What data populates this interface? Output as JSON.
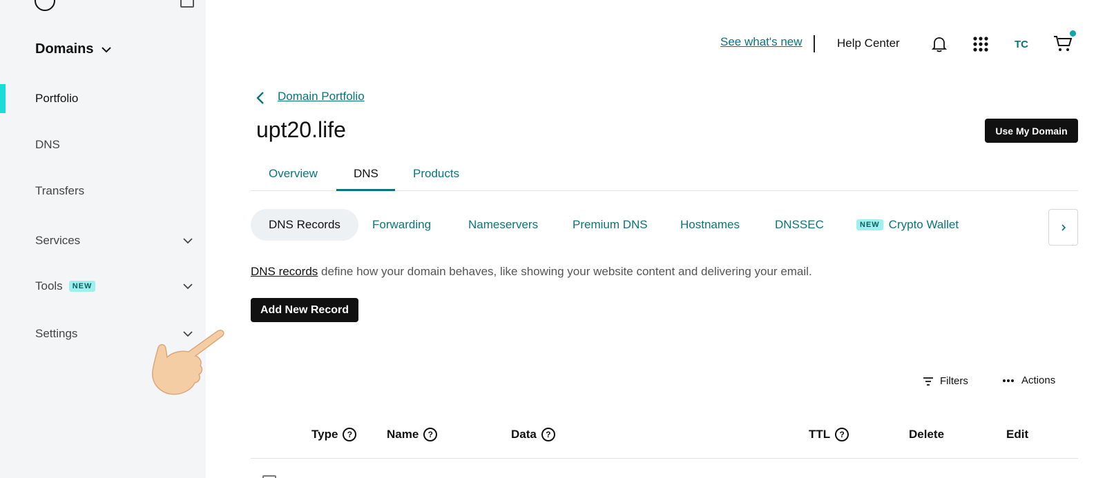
{
  "sidebar": {
    "title": "Domains",
    "items": [
      {
        "label": "Portfolio"
      },
      {
        "label": "DNS"
      },
      {
        "label": "Transfers"
      },
      {
        "label": "Services"
      },
      {
        "label": "Tools",
        "badge": "NEW"
      },
      {
        "label": "Settings"
      }
    ]
  },
  "topbar": {
    "whats_new": "See what's new",
    "help_center": "Help Center",
    "initials": "TC"
  },
  "breadcrumb": "Domain Portfolio",
  "page_title": "upt20.life",
  "use_domain_button": "Use My Domain",
  "tabs": [
    "Overview",
    "DNS",
    "Products"
  ],
  "subtabs": {
    "items": [
      "DNS Records",
      "Forwarding",
      "Nameservers",
      "Premium DNS",
      "Hostnames",
      "DNSSEC"
    ],
    "new_badge": "NEW",
    "crypto": "Crypto Wallet"
  },
  "description": {
    "link": "DNS records",
    "text": " define how your domain behaves, like showing your website content and delivering your email."
  },
  "add_record_button": "Add New Record",
  "toolbar": {
    "filters": "Filters",
    "actions": "Actions"
  },
  "table": {
    "columns": [
      "Type",
      "Name",
      "Data",
      "TTL",
      "Delete",
      "Edit"
    ]
  },
  "colors": {
    "accent": "#09757a",
    "active_bar": "#1bdbdb",
    "sidebar_bg": "#f3f5f6"
  }
}
